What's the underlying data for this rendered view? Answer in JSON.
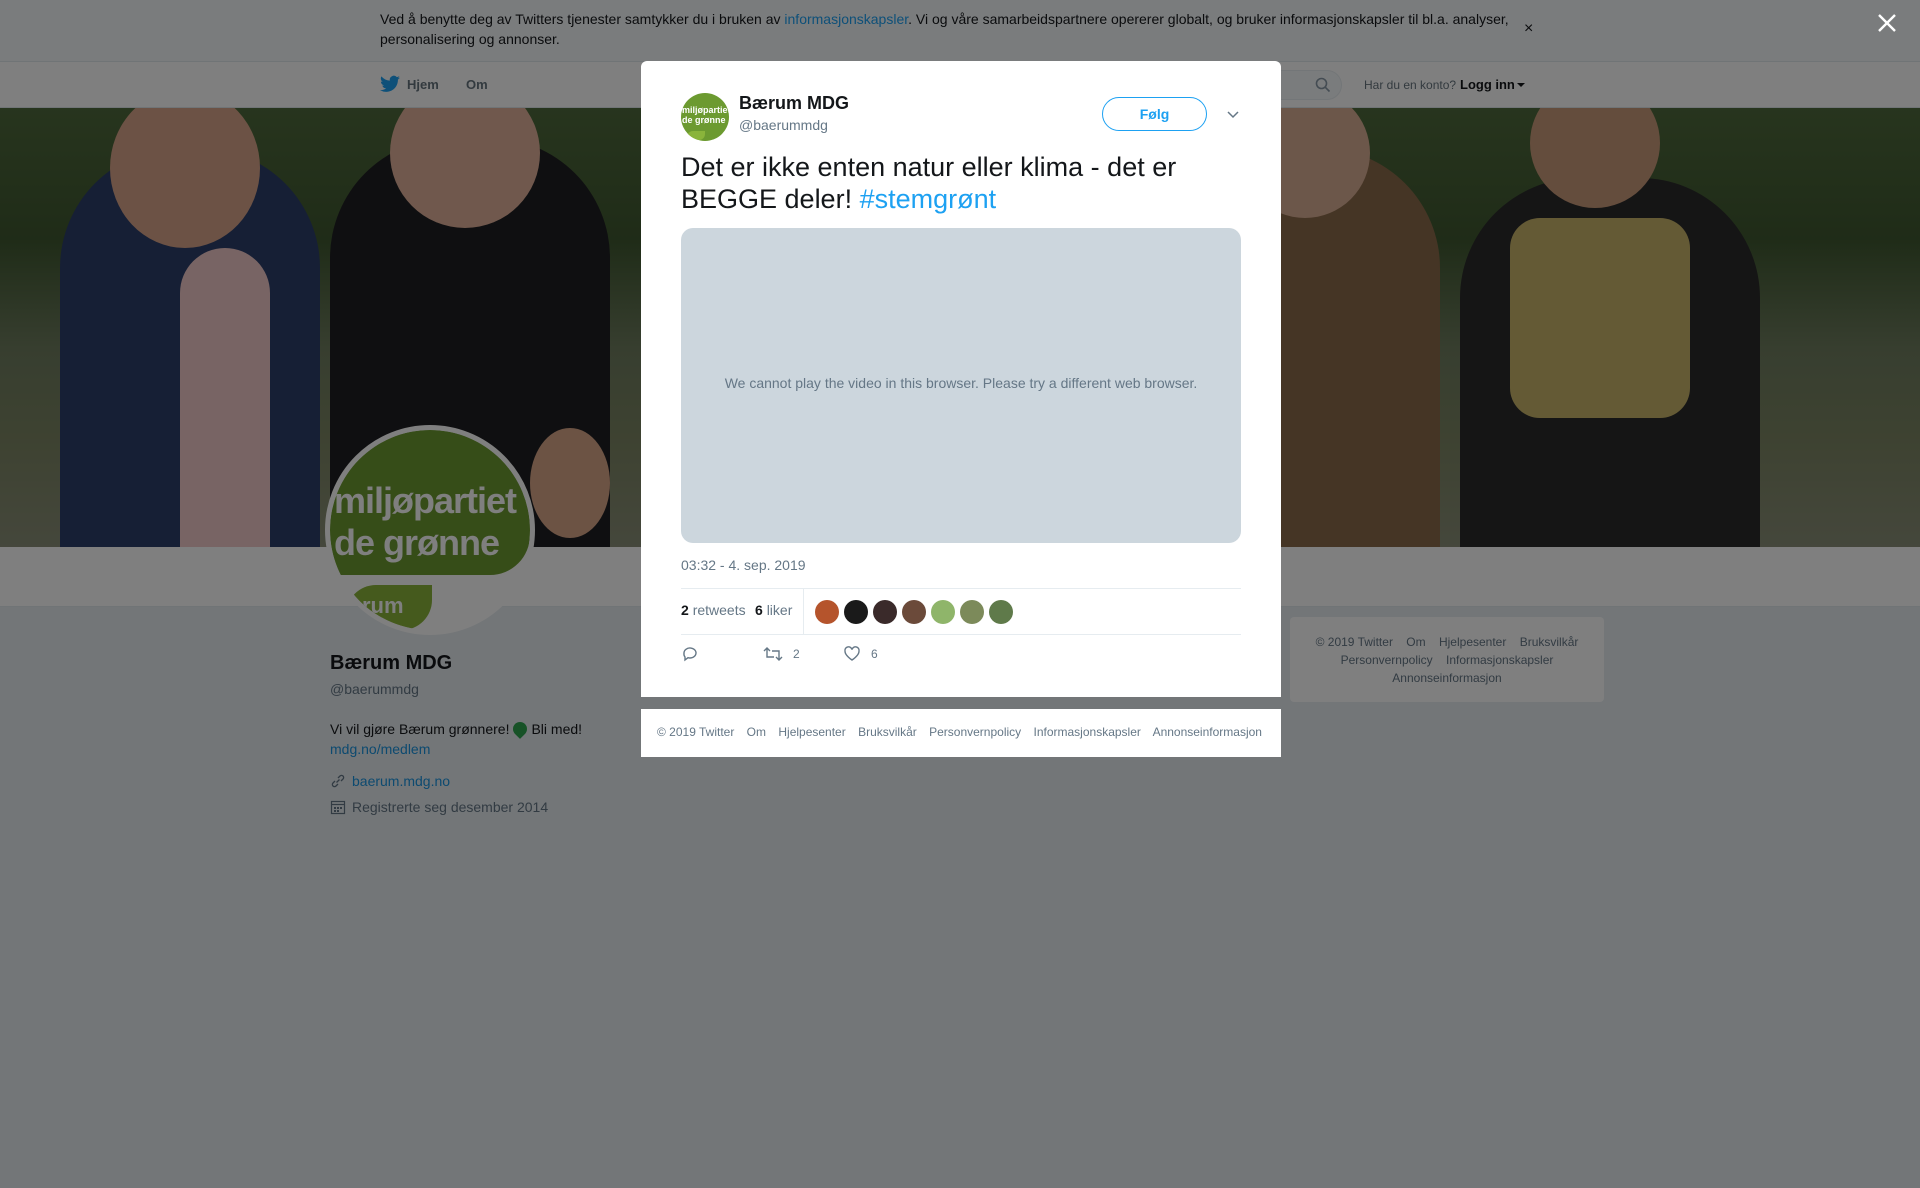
{
  "cookie_banner": {
    "text_before": "Ved å benytte deg av Twitters tjenester samtykker du i bruken av ",
    "link": "informasjonskapsler",
    "text_after": ". Vi og våre samarbeidspartnere opererer globalt, og bruker informasjonskapsler til bl.a. analyser, personalisering og annonser.",
    "close": "×"
  },
  "nav": {
    "home": "Hjem",
    "about": "Om",
    "account_question": "Har du en konto?",
    "login": "Logg inn"
  },
  "profile": {
    "avatar_line1": "miljøpartiet",
    "avatar_line2": "de grønne",
    "avatar_sub": "rum",
    "name": "Bærum MDG",
    "handle": "@baerummdg",
    "bio_before": "Vi vil gjøre Bærum grønnere!",
    "bio_after": "Bli med!",
    "bio_link": "mdg.no/medlem",
    "website": "baerum.mdg.no",
    "joined": "Registrerte seg desember 2014"
  },
  "side_footer": {
    "links_line1": [
      "© 2019 Twitter",
      "Om",
      "Hjelpesenter",
      "Bruksvilkår"
    ],
    "links_line2": [
      "Personvernpolicy",
      "Informasjonskapsler"
    ],
    "links_line3": [
      "Annonseinformasjon"
    ]
  },
  "tweet": {
    "avatar_line1": "miljøpartiet",
    "avatar_line2": "de grønne",
    "name": "Bærum MDG",
    "handle": "@baerummdg",
    "follow": "Følg",
    "text": "Det er ikke enten natur eller klima - det er BEGGE deler! ",
    "hashtag": "#stemgrønt",
    "video_message": "We cannot play the video in this browser. Please try a different web browser.",
    "timestamp": "03:32 - 4. sep. 2019",
    "retweets_count": "2",
    "retweets_label": "retweets",
    "likes_count": "6",
    "likes_label": "liker",
    "liker_avatar_colors": [
      "#b5542c",
      "#1a1a1a",
      "#3a2a2a",
      "#6b4a3a",
      "#8fb56a",
      "#7c8a5a",
      "#5f7a4a"
    ],
    "action_retweet_count": "2",
    "action_like_count": "6"
  },
  "modal_footer": {
    "links": [
      "© 2019 Twitter",
      "Om",
      "Hjelpesenter",
      "Bruksvilkår",
      "Personvernpolicy",
      "Informasjonskapsler",
      "Annonseinformasjon"
    ]
  },
  "colors": {
    "accent": "#1da1f2",
    "brand_green": "#6c9a30"
  }
}
